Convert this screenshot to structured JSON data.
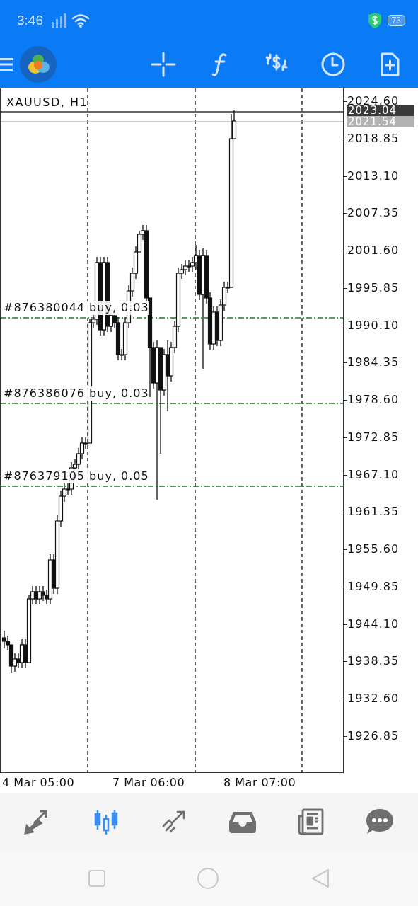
{
  "status_bar": {
    "time": "3:46",
    "battery": "73"
  },
  "chart": {
    "symbol": "XAUUSD, H1",
    "bid_label": "2023.04",
    "ask_label": "2021.54",
    "price_ticks": [
      "2024.60",
      "2018.85",
      "2013.10",
      "2007.35",
      "2001.60",
      "1995.85",
      "1990.10",
      "1984.35",
      "1978.60",
      "1972.85",
      "1967.10",
      "1961.35",
      "1955.60",
      "1949.85",
      "1944.10",
      "1938.35",
      "1932.60",
      "1926.85"
    ],
    "orders": [
      "#876380044 buy, 0.03",
      "#876386076 buy, 0.03",
      "#876379105 buy, 0.05"
    ],
    "time_labels": [
      "4 Mar 05:00",
      "7 Mar 06:00",
      "8 Mar 07:00"
    ]
  },
  "tabs": [
    {
      "kind": "quotes",
      "selected": false
    },
    {
      "kind": "chart",
      "selected": true
    },
    {
      "kind": "trade",
      "selected": false
    },
    {
      "kind": "history",
      "selected": false
    },
    {
      "kind": "news",
      "selected": false
    },
    {
      "kind": "chat",
      "selected": false
    }
  ]
}
